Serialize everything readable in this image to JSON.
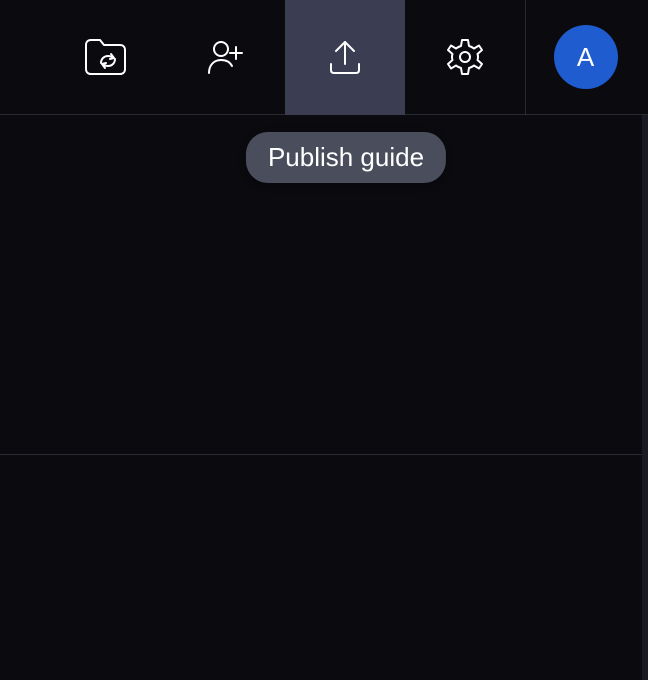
{
  "toolbar": {
    "items": [
      {
        "name": "folder-sync-button",
        "icon": "folder-sync-icon"
      },
      {
        "name": "add-user-button",
        "icon": "add-user-icon"
      },
      {
        "name": "publish-button",
        "icon": "upload-icon",
        "active": true,
        "tooltip": "Publish guide"
      },
      {
        "name": "settings-button",
        "icon": "gear-icon"
      }
    ]
  },
  "user": {
    "avatar_initial": "A"
  },
  "tooltip": {
    "text": "Publish guide"
  }
}
